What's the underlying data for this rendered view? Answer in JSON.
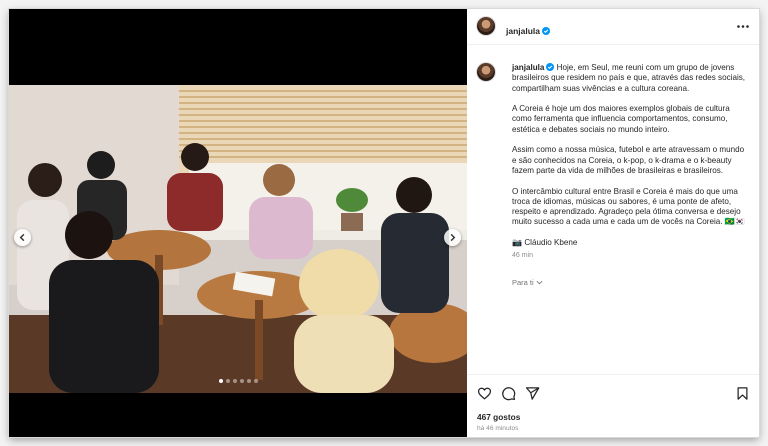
{
  "post": {
    "username": "janjalula",
    "caption": {
      "username": "janjalula",
      "paragraphs": [
        "Hoje, em Seul, me reuni com um grupo de jovens brasileiros que residem no país e que, através das redes sociais, compartilham suas vivências e a cultura coreana.",
        "A Coreia é hoje um dos maiores exemplos globais de cultura como ferramenta que influencia comportamentos, consumo, estética e debates sociais no mundo inteiro.",
        "Assim como a nossa música, futebol e arte atravessam o mundo e são conhecidos na Coreia, o k-pop, o k-drama e o k-beauty fazem parte da vida de milhões de brasileiras e brasileiros.",
        "O intercâmbio cultural entre Brasil e Coreia é mais do que uma troca de idiomas, músicas ou sabores, é uma ponte de afeto, respeito e aprendizado. Agradeço pela ótima conversa e desejo muito sucesso a cada uma e cada um de vocês na Coreia. 🇧🇷🇰🇷"
      ],
      "credit": "📷 Cláudio Kbene",
      "time": "46 min"
    },
    "translate_label": "Para ti",
    "likes": "467 gostos",
    "posted_ago": "há 46 minutos"
  },
  "carousel": {
    "total": 6,
    "active_index": 0
  },
  "icons": {
    "verified": "verified-badge-icon",
    "more": "more-options-icon",
    "like": "heart-icon",
    "comment": "comment-icon",
    "share": "send-icon",
    "save": "bookmark-icon",
    "prev": "chevron-left-icon",
    "next": "chevron-right-icon"
  },
  "colors": {
    "verified": "#0095f6",
    "text": "#262626",
    "muted": "#8e8e8e"
  }
}
